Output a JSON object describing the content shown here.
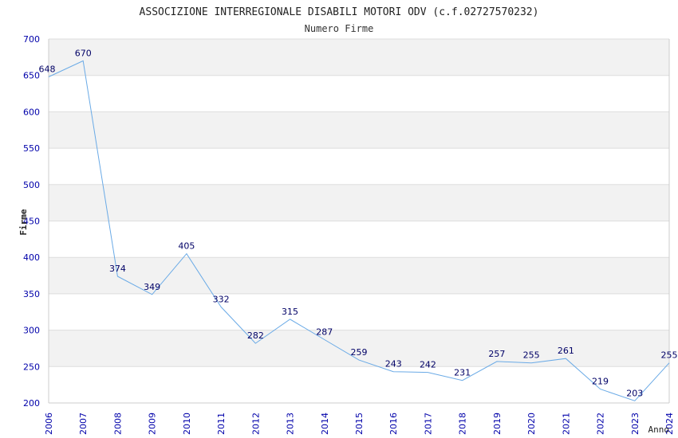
{
  "chart_data": {
    "type": "line",
    "title": "ASSOCIZIONE INTERREGIONALE DISABILI MOTORI ODV (c.f.02727570232)",
    "subtitle": "Numero Firme",
    "xlabel": "Anno",
    "ylabel": "Firme",
    "x": [
      "2006",
      "2007",
      "2008",
      "2009",
      "2010",
      "2011",
      "2012",
      "2013",
      "2014",
      "2015",
      "2016",
      "2017",
      "2018",
      "2019",
      "2020",
      "2021",
      "2022",
      "2023",
      "2024"
    ],
    "values": [
      648,
      670,
      374,
      349,
      405,
      332,
      282,
      315,
      287,
      259,
      243,
      242,
      231,
      257,
      255,
      261,
      219,
      203,
      255
    ],
    "ylim": [
      200,
      700
    ],
    "yticks": [
      200,
      250,
      300,
      350,
      400,
      450,
      500,
      550,
      600,
      650,
      700
    ],
    "grid": true,
    "banded_background": true,
    "colors": {
      "line": "#6aaae6",
      "tick_label": "#0000aa",
      "data_label": "#000066",
      "band_dark": "#f2f2f2",
      "band_light": "#ffffff",
      "grid": "#dddddd",
      "axis": "#cccccc"
    }
  }
}
